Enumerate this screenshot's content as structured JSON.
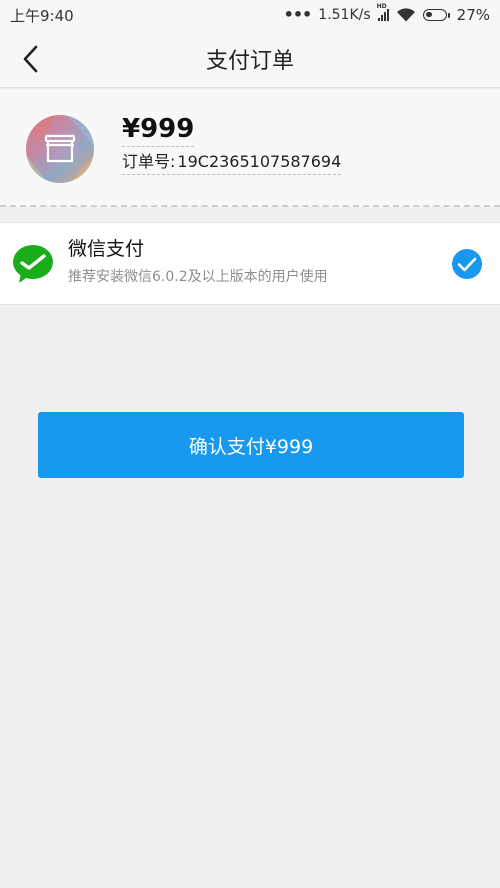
{
  "status_bar": {
    "time": "上午9:40",
    "dots": "•••",
    "network_speed": "1.51K/s",
    "signal_tag": "HD",
    "battery": "27%"
  },
  "nav": {
    "title": "支付订单",
    "back_icon": "chevron-left-icon"
  },
  "order": {
    "amount": "¥999",
    "order_no_label": "订单号:",
    "order_no_value": "19C2365107587694",
    "avatar_icon": "shop-icon"
  },
  "payment": {
    "method_name": "微信支付",
    "method_desc": "推荐安装微信6.0.2及以上版本的用户使用",
    "method_icon": "wechat-pay-icon",
    "selected": true,
    "check_icon": "check-circle-icon"
  },
  "confirm": {
    "label": "确认支付¥999"
  },
  "colors": {
    "accent": "#1898ee",
    "wechat_green": "#1aad19",
    "background": "#efefef"
  }
}
